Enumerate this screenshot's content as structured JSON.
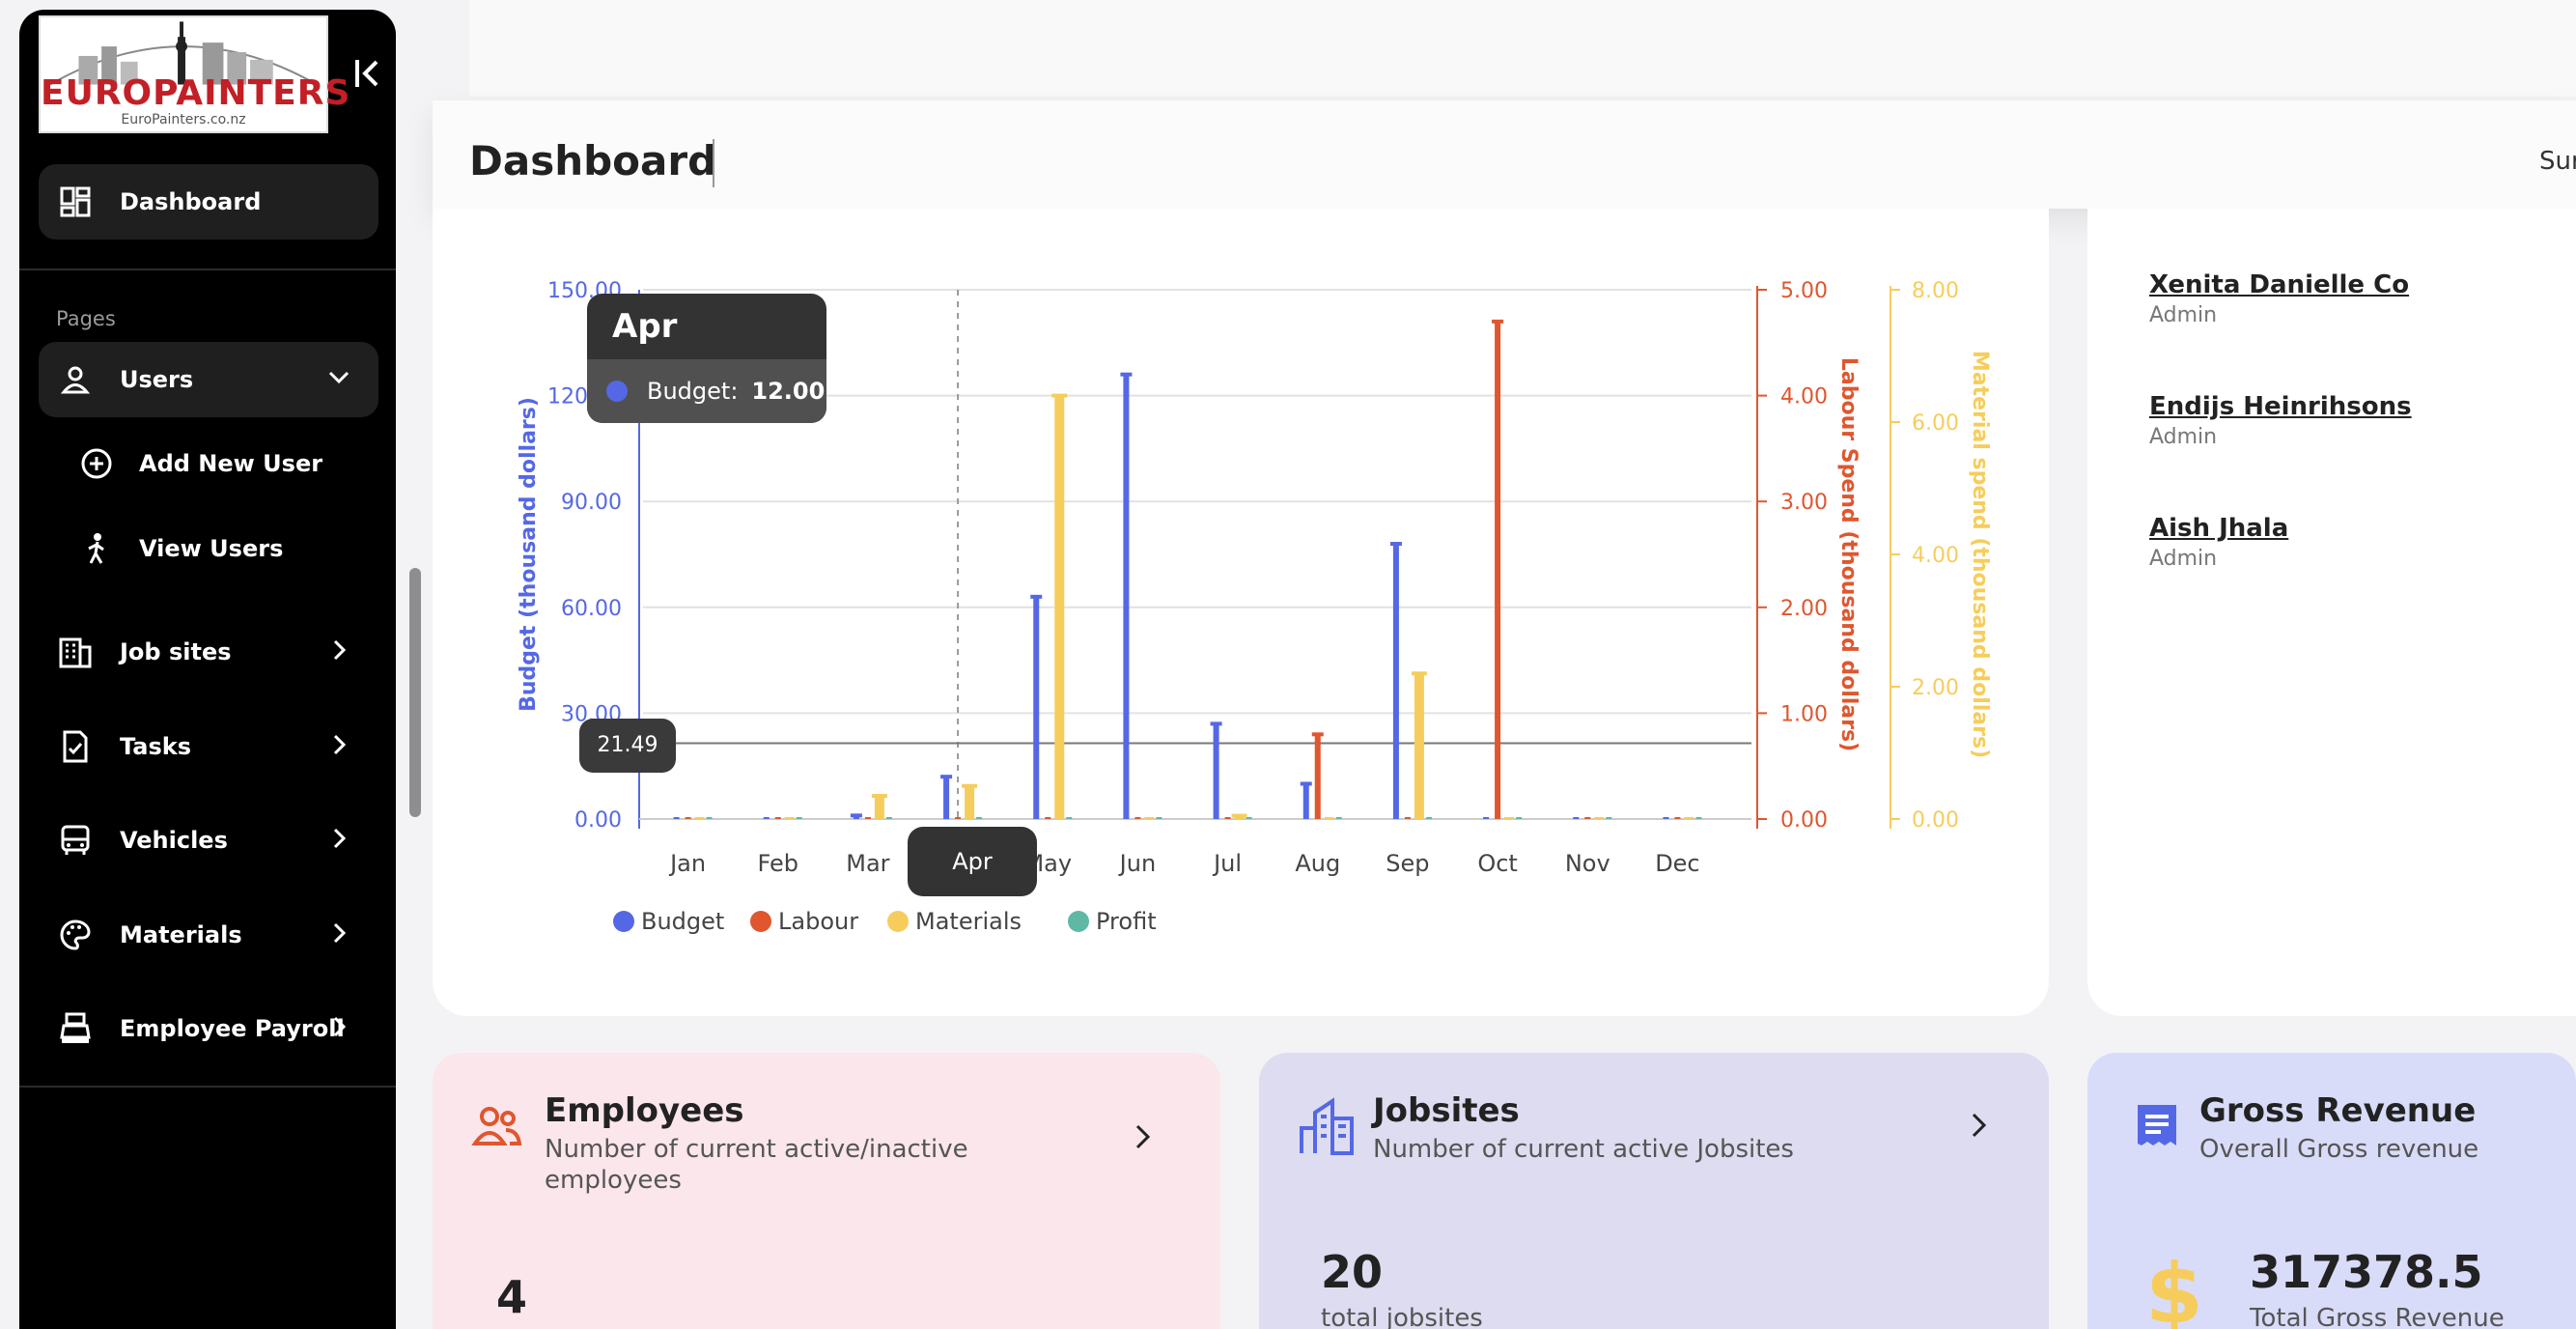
{
  "sidebar": {
    "logo": {
      "brand": "EUROPAINTERS",
      "url": "EuroPainters.co.nz"
    },
    "pages_label": "Pages",
    "items": [
      {
        "label": "Dashboard",
        "icon": "dashboard-icon"
      },
      {
        "label": "Users",
        "icon": "user-icon"
      },
      {
        "label": "Job sites",
        "icon": "building-icon"
      },
      {
        "label": "Tasks",
        "icon": "task-icon"
      },
      {
        "label": "Vehicles",
        "icon": "bus-icon"
      },
      {
        "label": "Materials",
        "icon": "palette-icon"
      },
      {
        "label": "Employee Payroll",
        "icon": "cash-register-icon"
      }
    ],
    "user_subitems": [
      {
        "label": "Add New User",
        "icon": "plus-circle-icon"
      },
      {
        "label": "View Users",
        "icon": "person-walking-icon"
      }
    ]
  },
  "header": {
    "title": "Dashboard",
    "right_text": "Sur"
  },
  "tooltip": {
    "title": "Apr",
    "series": "Budget:",
    "value": "12.00"
  },
  "crosshair_value": "21.49",
  "colors": {
    "budget": "#5468e6",
    "labour": "#e0562e",
    "materials": "#f6cd5c",
    "profit": "#5fb8a3"
  },
  "chart_data": {
    "type": "bar",
    "categories": [
      "Jan",
      "Feb",
      "Mar",
      "Apr",
      "May",
      "Jun",
      "Jul",
      "Aug",
      "Sep",
      "Oct",
      "Nov",
      "Dec"
    ],
    "series": [
      {
        "name": "Budget",
        "axis": "left",
        "values": [
          0,
          0,
          1,
          12,
          63,
          126,
          27,
          10,
          78,
          0,
          0,
          0
        ]
      },
      {
        "name": "Labour",
        "axis": "right1",
        "values": [
          0,
          0,
          0,
          0,
          0,
          0,
          0,
          0.8,
          0,
          4.7,
          0,
          0
        ]
      },
      {
        "name": "Materials",
        "axis": "right2",
        "values": [
          0,
          0,
          0.35,
          0.5,
          6.4,
          0,
          0.05,
          0,
          2.2,
          0,
          0,
          0
        ]
      },
      {
        "name": "Profit",
        "axis": "left",
        "values": [
          0,
          0,
          0,
          0,
          0,
          0,
          0,
          0,
          0,
          0,
          0,
          0
        ]
      }
    ],
    "ylabel_left": "Budget (thousand dollars)",
    "ylabel_right1": "Labour Spend (thousand dollars)",
    "ylabel_right2": "Material spend (thousand dollars)",
    "ylim_left": [
      0,
      150
    ],
    "ylim_right1": [
      0,
      5
    ],
    "ylim_right2": [
      0,
      8
    ],
    "yticks_left": [
      "0.00",
      "30.00",
      "60.00",
      "90.00",
      "120.00",
      "150.00"
    ],
    "yticks_right1": [
      "0.00",
      "1.00",
      "2.00",
      "3.00",
      "4.00",
      "5.00"
    ],
    "yticks_right2": [
      "0.00",
      "2.00",
      "4.00",
      "6.00",
      "8.00"
    ],
    "legend": [
      "Budget",
      "Labour",
      "Materials",
      "Profit"
    ],
    "legend_position": "bottom-left",
    "grid": true
  },
  "team": [
    {
      "name": "Xenita Danielle Co",
      "role": "Admin"
    },
    {
      "name": "Endijs Heinrihsons",
      "role": "Admin"
    },
    {
      "name": "Aish Jhala",
      "role": "Admin"
    }
  ],
  "stats": [
    {
      "title": "Employees",
      "subtitle": "Number of current active/inactive employees",
      "value": "4",
      "caption": "",
      "icon": "people-icon",
      "bg": "#fbe6ec",
      "accent": "#e0562e"
    },
    {
      "title": "Jobsites",
      "subtitle": "Number of current active Jobsites",
      "value": "20",
      "caption": "total jobsites",
      "icon": "city-building-icon",
      "bg": "#dedcf0",
      "accent": "#5468e6"
    },
    {
      "title": "Gross Revenue",
      "subtitle": "Overall Gross revenue",
      "value": "317378.5",
      "caption": "Total Gross Revenue",
      "icon": "receipt-icon",
      "bg": "#d9dcf8",
      "accent": "#5468e6"
    }
  ]
}
